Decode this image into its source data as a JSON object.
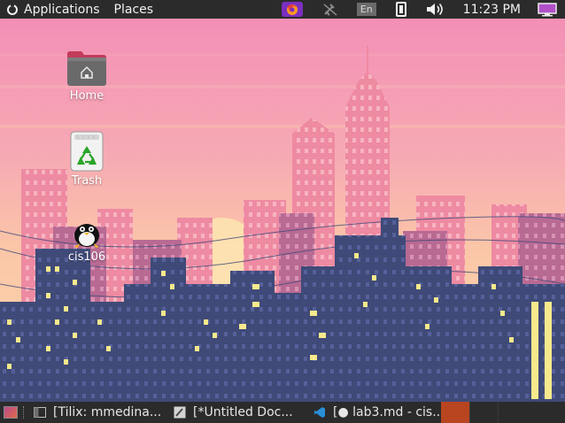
{
  "top_panel": {
    "applications_label": "Applications",
    "places_label": "Places",
    "keyboard_layout": "En",
    "clock": "11:23 PM",
    "icons": [
      "firefox-icon",
      "network-disconnected-icon",
      "battery-icon",
      "volume-icon",
      "display-settings-icon"
    ]
  },
  "desktop": {
    "icons": [
      {
        "label": "Home",
        "icon": "home-folder-icon"
      },
      {
        "label": "Trash",
        "icon": "trash-icon"
      },
      {
        "label": "cis106",
        "icon": "penguin-folder-icon"
      }
    ]
  },
  "taskbar": {
    "tasks": [
      {
        "label": "[Tilix: mmedina...",
        "icon": "terminal-icon"
      },
      {
        "label": "[*Untitled Doc...",
        "icon": "text-editor-icon"
      },
      {
        "label": "[● lab3.md - cis...",
        "icon": "vscode-icon"
      }
    ],
    "workspace_colors": {
      "active": "#b8451f",
      "inactive": "#2b2b2b"
    }
  },
  "colors": {
    "panel": "#2b2b2b",
    "sky_top": "#f48fb6",
    "sky_bottom": "#fbd1a2",
    "building_dark": "#3f4a78",
    "building_far": "#ec7c98",
    "window_light": "#f7e98c"
  }
}
